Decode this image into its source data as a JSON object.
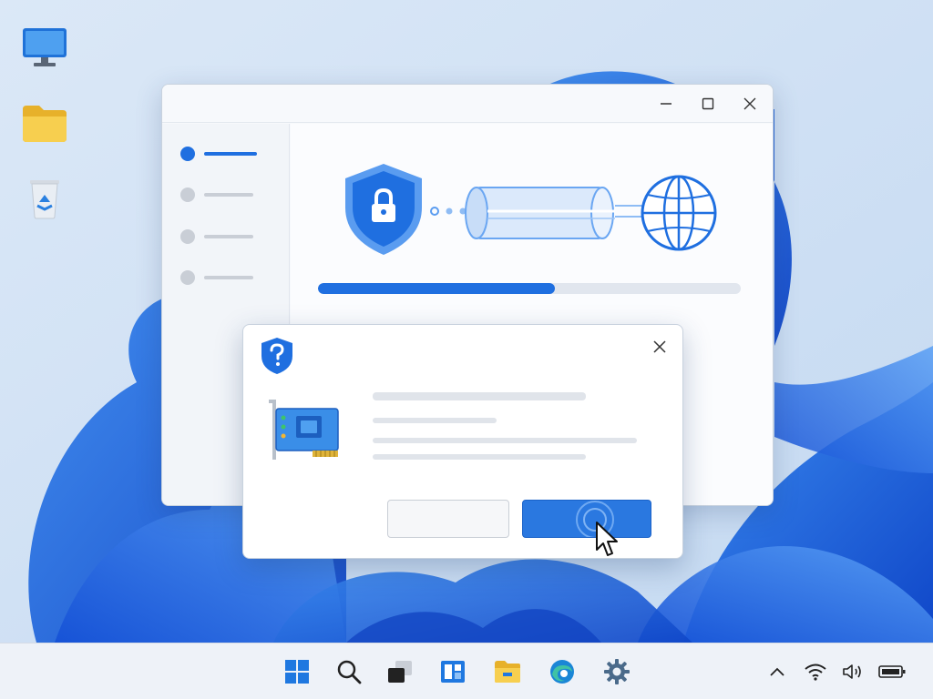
{
  "colors": {
    "accent": "#1f6fe0",
    "primary_button": "#2a78e0",
    "wallpaper_bloom": "#1a5fe0",
    "folder": "#f2c43c"
  },
  "desktop": {
    "icons": [
      "monitor-icon",
      "folder-icon",
      "recycle-bin-icon"
    ]
  },
  "main_window": {
    "controls": [
      "minimize-icon",
      "maximize-icon",
      "close-icon"
    ],
    "sidebar_items": [
      {
        "active": true
      },
      {
        "active": false
      },
      {
        "active": false
      },
      {
        "active": false
      }
    ],
    "illustration": [
      "shield-lock-icon",
      "tunnel-icon",
      "globe-icon"
    ],
    "progress": 0.56
  },
  "dialog": {
    "icons": [
      "shield-question-icon",
      "network-card-icon",
      "close-icon"
    ],
    "buttons": [
      "secondary-button",
      "primary-button"
    ]
  },
  "taskbar": {
    "apps": [
      "start-icon",
      "search-icon",
      "task-view-icon",
      "widgets-icon",
      "file-explorer-icon",
      "edge-icon",
      "settings-icon"
    ],
    "tray": [
      "chevron-up-icon",
      "wifi-icon",
      "volume-icon",
      "battery-icon"
    ]
  }
}
